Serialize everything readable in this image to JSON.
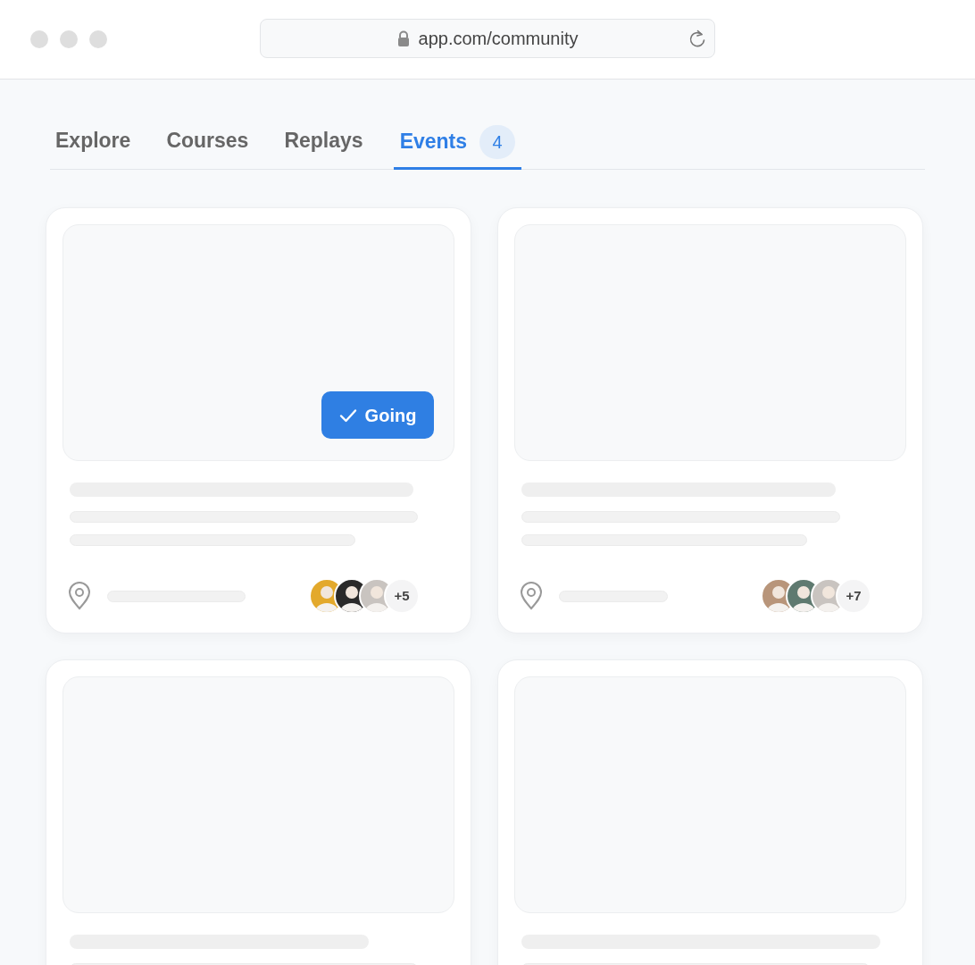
{
  "browser": {
    "url": "app.com/community"
  },
  "tabs": [
    {
      "label": "Explore",
      "selected": false
    },
    {
      "label": "Courses",
      "selected": false
    },
    {
      "label": "Replays",
      "selected": false
    },
    {
      "label": "Events",
      "selected": true,
      "badge": "4"
    }
  ],
  "cards": [
    {
      "going": true,
      "going_label": "Going",
      "attendees": {
        "avatars": [
          {
            "color": "#e3a92c"
          },
          {
            "color": "#2a2a2a"
          },
          {
            "color": "#c9c4c0"
          }
        ],
        "more": "+5"
      }
    },
    {
      "going": false,
      "attendees": {
        "avatars": [
          {
            "color": "#b8957a"
          },
          {
            "color": "#5f7a70"
          },
          {
            "color": "#c9c4c0"
          }
        ],
        "more": "+7"
      }
    },
    {
      "going": false
    },
    {
      "going": false
    }
  ]
}
